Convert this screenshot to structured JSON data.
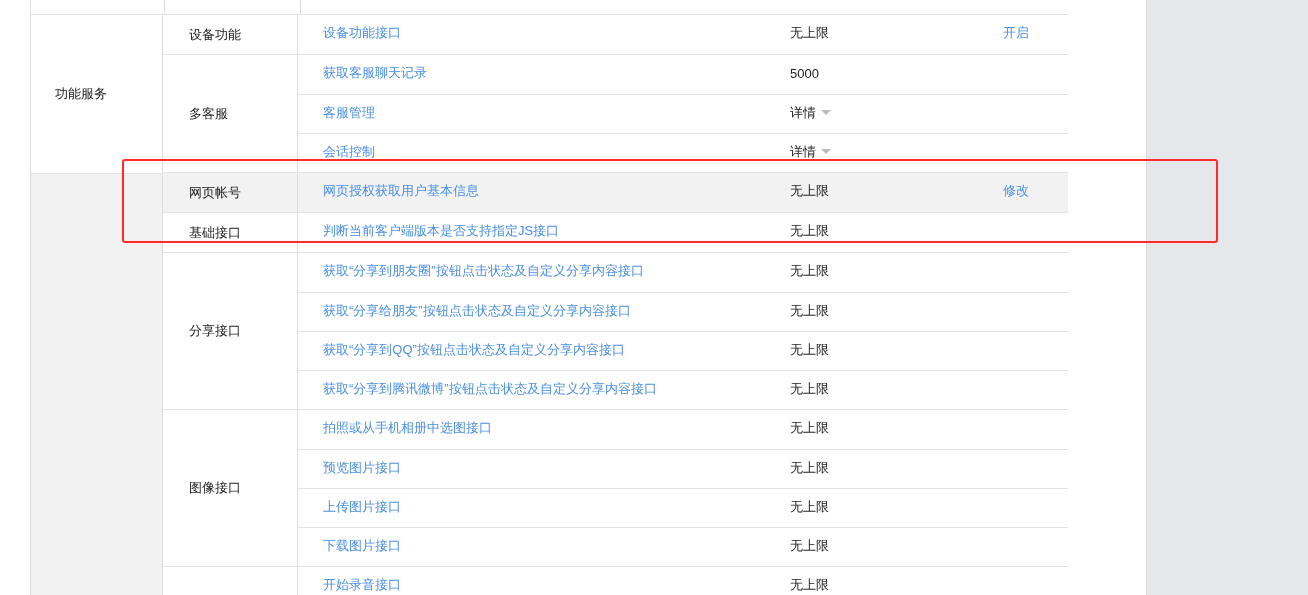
{
  "groups": [
    {
      "name": "功能服务",
      "highlighted": false,
      "subgroups": [
        {
          "name": "设备功能",
          "rows": [
            {
              "name": "设备功能接口",
              "kind": "text",
              "value": "无上限",
              "action": "开启",
              "highlighted": false
            }
          ]
        },
        {
          "name": "多客服",
          "rows": [
            {
              "name": "获取客服聊天记录",
              "kind": "text",
              "value": "5000",
              "highlighted": false
            },
            {
              "name": "客服管理",
              "kind": "dropdown",
              "value": "详情",
              "highlighted": false
            },
            {
              "name": "会话控制",
              "kind": "dropdown",
              "value": "详情",
              "highlighted": false
            }
          ]
        }
      ]
    },
    {
      "highlighted": true,
      "subgroups": [
        {
          "name": "网页帐号",
          "rows": [
            {
              "name": "网页授权获取用户基本信息",
              "kind": "text",
              "value": "无上限",
              "action": "修改",
              "highlighted": true
            }
          ]
        },
        {
          "name": "基础接口",
          "rows": [
            {
              "name": "判断当前客户端版本是否支持指定JS接口",
              "kind": "text",
              "value": "无上限",
              "highlighted": false
            }
          ]
        },
        {
          "name": "分享接口",
          "rows": [
            {
              "name": "获取“分享到朋友圈”按钮点击状态及自定义分享内容接口",
              "kind": "text",
              "value": "无上限",
              "highlighted": false
            },
            {
              "name": "获取“分享给朋友”按钮点击状态及自定义分享内容接口",
              "kind": "text",
              "value": "无上限",
              "highlighted": false
            },
            {
              "name": "获取“分享到QQ”按钮点击状态及自定义分享内容接口",
              "kind": "text",
              "value": "无上限",
              "highlighted": false
            },
            {
              "name": "获取“分享到腾讯微博”按钮点击状态及自定义分享内容接口",
              "kind": "text",
              "value": "无上限",
              "highlighted": false
            }
          ]
        },
        {
          "name": "图像接口",
          "rows": [
            {
              "name": "拍照或从手机相册中选图接口",
              "kind": "text",
              "value": "无上限",
              "highlighted": false
            },
            {
              "name": "预览图片接口",
              "kind": "text",
              "value": "无上限",
              "highlighted": false
            },
            {
              "name": "上传图片接口",
              "kind": "text",
              "value": "无上限",
              "highlighted": false
            },
            {
              "name": "下载图片接口",
              "kind": "text",
              "value": "无上限",
              "highlighted": false
            }
          ]
        },
        {
          "rows": [
            {
              "name": "开始录音接口",
              "kind": "text",
              "value": "无上限",
              "highlighted": false
            }
          ]
        }
      ]
    }
  ],
  "annotation": {
    "kind": "rectangle",
    "color": "#ff2a2a"
  }
}
